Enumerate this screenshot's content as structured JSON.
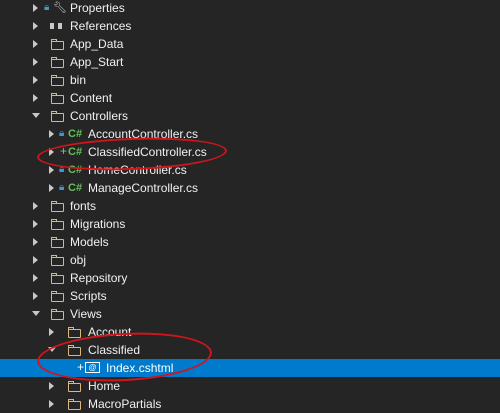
{
  "tree": {
    "items": [
      {
        "label": "Properties"
      },
      {
        "label": "References"
      },
      {
        "label": "App_Data"
      },
      {
        "label": "App_Start"
      },
      {
        "label": "bin"
      },
      {
        "label": "Content"
      },
      {
        "label": "Controllers"
      },
      {
        "label": "AccountController.cs"
      },
      {
        "label": "ClassifiedController.cs"
      },
      {
        "label": "HomeController.cs"
      },
      {
        "label": "ManageController.cs"
      },
      {
        "label": "fonts"
      },
      {
        "label": "Migrations"
      },
      {
        "label": "Models"
      },
      {
        "label": "obj"
      },
      {
        "label": "Repository"
      },
      {
        "label": "Scripts"
      },
      {
        "label": "Views"
      },
      {
        "label": "Account"
      },
      {
        "label": "Classified"
      },
      {
        "label": "Index.cshtml"
      },
      {
        "label": "Home"
      },
      {
        "label": "MacroPartials"
      }
    ],
    "csharp_badge": "C#",
    "annotation_color": "#d0161b",
    "selection_color": "#007acc"
  }
}
